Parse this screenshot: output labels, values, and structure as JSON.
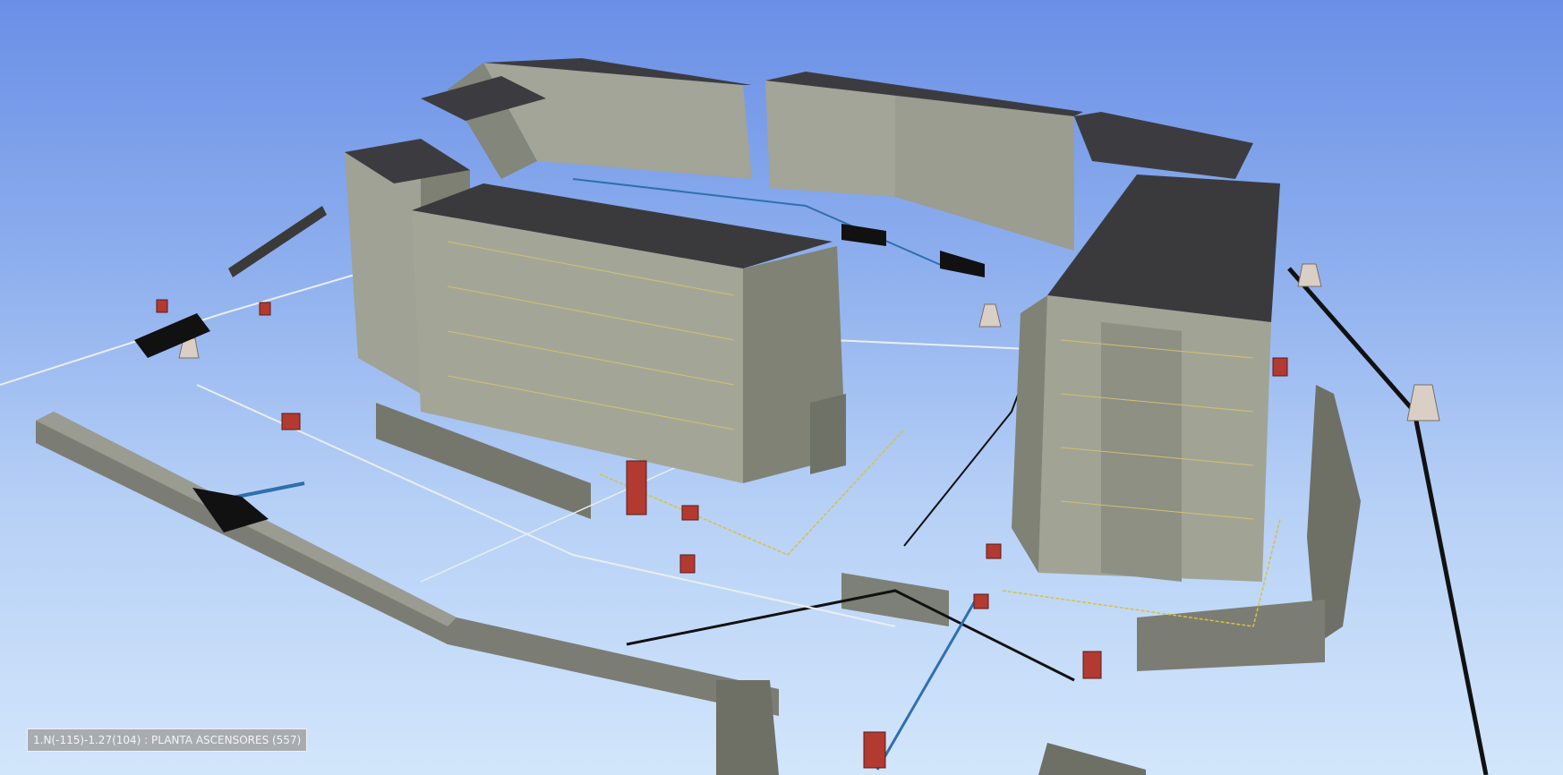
{
  "viewport": {
    "status_label": "1.N(-115)-1.27(104) : PLANTA ASCENSORES (557)"
  },
  "colors": {
    "sky_top": "#6a8fe6",
    "sky_bottom": "#d2e6fb",
    "wall": "#9fa294",
    "wall_dark": "#7d8073",
    "roof": "#3c3c40",
    "retaining_wall": "#7b7d74",
    "pipe_black": "#111111",
    "pipe_blue": "#2f6fb0",
    "pipe_yellow": "#d8c23a",
    "manhole_red": "#b23a30"
  }
}
